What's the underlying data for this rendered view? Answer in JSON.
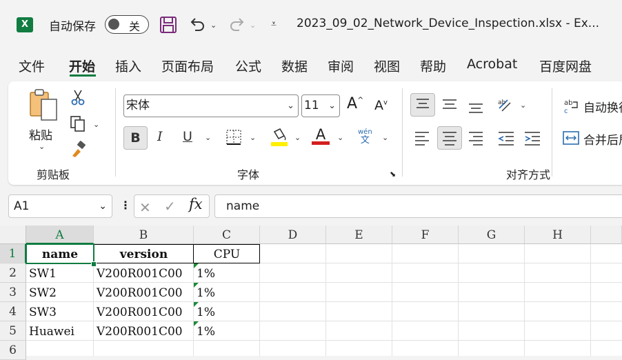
{
  "titlebar": {
    "app_icon": "X",
    "autosave_label": "自动保存",
    "autosave_state": "关",
    "filename": "2023_09_02_Network_Device_Inspection.xlsx  -  Ex..."
  },
  "menu": {
    "tabs": [
      "文件",
      "开始",
      "插入",
      "页面布局",
      "公式",
      "数据",
      "审阅",
      "视图",
      "帮助",
      "Acrobat",
      "百度网盘"
    ],
    "active": "开始"
  },
  "ribbon": {
    "clipboard": {
      "paste_label": "粘贴",
      "group_label": "剪贴板"
    },
    "font": {
      "font_name": "宋体",
      "font_size": "11",
      "group_label": "字体",
      "grow": "A",
      "shrink": "A",
      "bold": "B",
      "italic": "I",
      "underline": "U",
      "font_color": "A",
      "phonetic_top": "wén",
      "phonetic_bottom": "文"
    },
    "alignment": {
      "wrap_text": "自动换行",
      "merge_center": "合并后居中",
      "group_label": "对齐方式"
    }
  },
  "formula_bar": {
    "name_box": "A1",
    "fx": "fx",
    "content": "name"
  },
  "sheet": {
    "columns": [
      "A",
      "B",
      "C",
      "D",
      "E",
      "F",
      "G",
      "H"
    ],
    "rows": [
      "1",
      "2",
      "3",
      "4",
      "5",
      "6"
    ],
    "headers": [
      "name",
      "version",
      "CPU"
    ],
    "data": [
      [
        "SW1",
        "V200R001C00",
        "1%"
      ],
      [
        "SW2",
        "V200R001C00",
        "1%"
      ],
      [
        "SW3",
        "V200R001C00",
        "1%"
      ],
      [
        "Huawei",
        "V200R001C00",
        "1%"
      ]
    ],
    "selected_cell": "A1"
  },
  "colors": {
    "accent": "#107c41",
    "underline_color": "#d31e1e",
    "highlight_color": "#ffef00"
  }
}
